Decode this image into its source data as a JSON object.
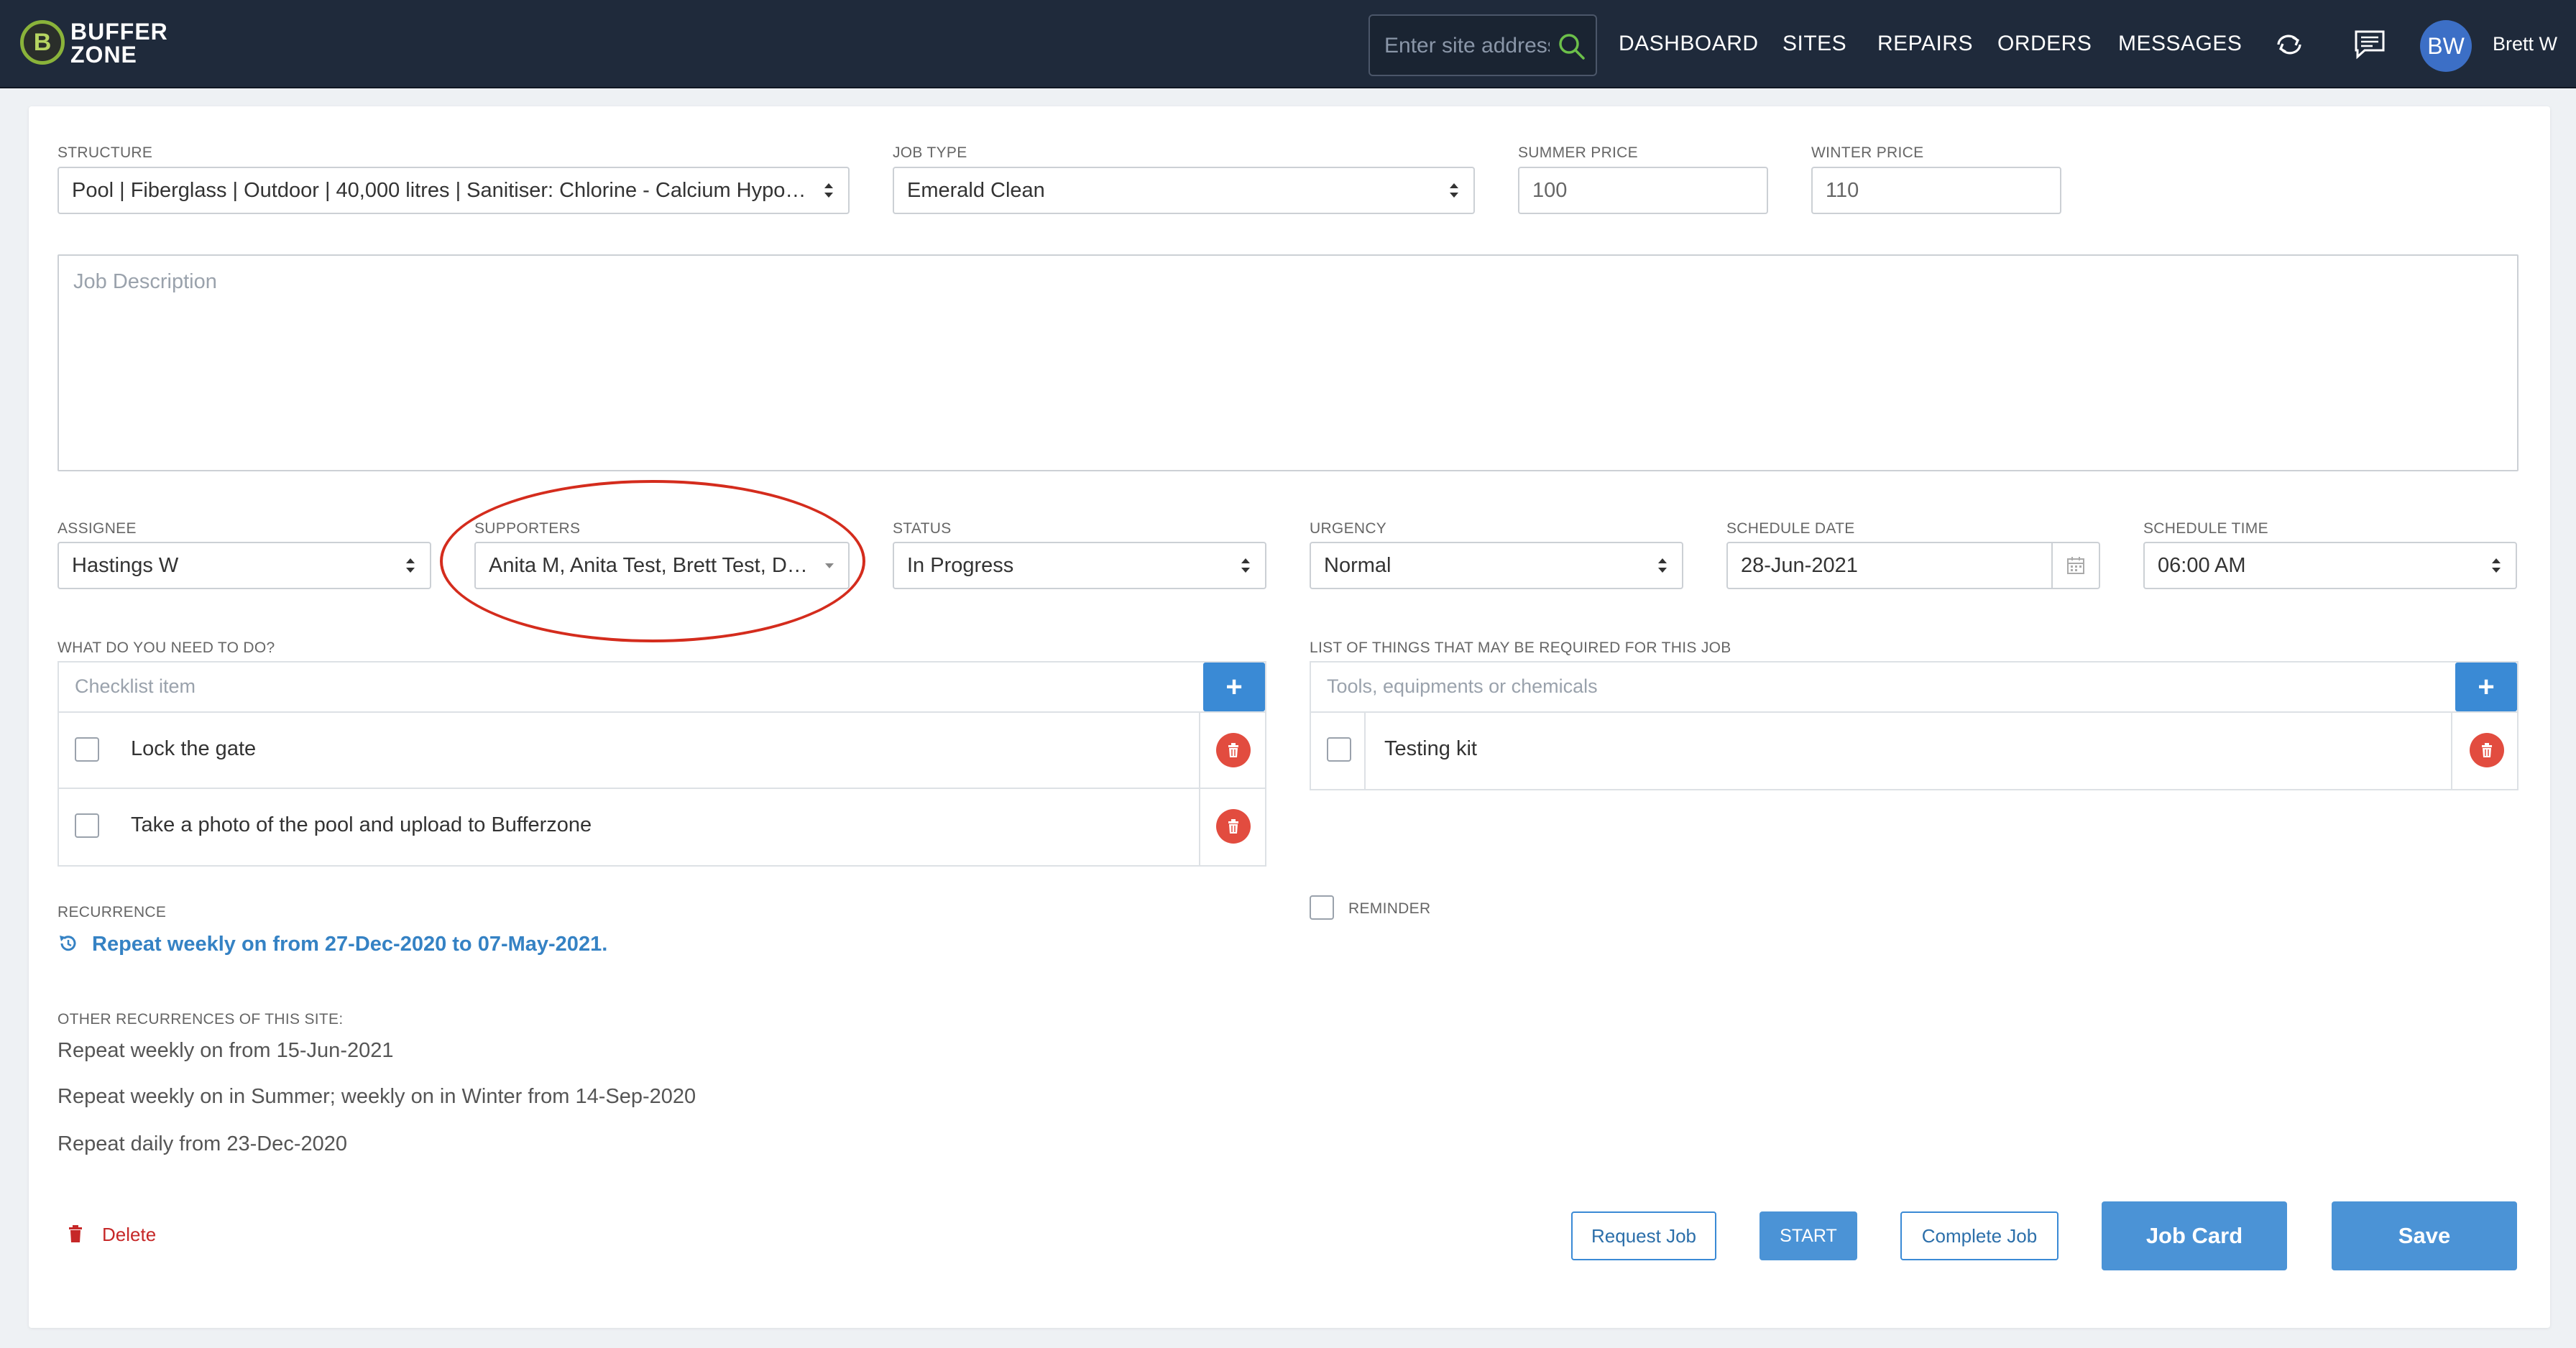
{
  "app": {
    "logo_letter": "B",
    "logo_line1": "BUFFER",
    "logo_line2": "ZONE"
  },
  "search": {
    "placeholder": "Enter site address"
  },
  "nav": [
    {
      "label": "DASHBOARD"
    },
    {
      "label": "SITES"
    },
    {
      "label": "REPAIRS"
    },
    {
      "label": "ORDERS"
    },
    {
      "label": "MESSAGES"
    }
  ],
  "user": {
    "initials": "BW",
    "name": "Brett W"
  },
  "form": {
    "structure": {
      "label": "STRUCTURE",
      "value": "Pool | Fiberglass | Outdoor | 40,000 litres | Sanitiser: Chlorine - Calcium Hypochlorite"
    },
    "job_type": {
      "label": "JOB TYPE",
      "value": "Emerald Clean"
    },
    "summer_price": {
      "label": "SUMMER PRICE",
      "value": "100"
    },
    "winter_price": {
      "label": "WINTER PRICE",
      "value": "110"
    },
    "job_description": {
      "placeholder": "Job Description"
    },
    "assignee": {
      "label": "ASSIGNEE",
      "value": "Hastings W"
    },
    "supporters": {
      "label": "SUPPORTERS",
      "value": "Anita M, Anita Test, Brett Test, David"
    },
    "status": {
      "label": "STATUS",
      "value": "In Progress"
    },
    "urgency": {
      "label": "URGENCY",
      "value": "Normal"
    },
    "schedule_date": {
      "label": "SCHEDULE DATE",
      "value": "28-Jun-2021"
    },
    "schedule_time": {
      "label": "SCHEDULE TIME",
      "value": "06:00 AM"
    }
  },
  "checklist": {
    "label": "WHAT DO YOU NEED TO DO?",
    "placeholder": "Checklist item",
    "add_label": "+",
    "items": [
      {
        "text": "Lock the gate"
      },
      {
        "text": "Take a photo of the pool and upload to Bufferzone"
      }
    ]
  },
  "requirements": {
    "label": "LIST OF THINGS THAT MAY BE REQUIRED FOR THIS JOB",
    "placeholder": "Tools, equipments or chemicals",
    "add_label": "+",
    "items": [
      {
        "text": "Testing kit"
      }
    ]
  },
  "reminder": {
    "label": "REMINDER"
  },
  "recurrence": {
    "label": "RECURRENCE",
    "value": "Repeat weekly on from 27-Dec-2020 to 07-May-2021."
  },
  "other_recurrences": {
    "label": "OTHER RECURRENCES OF THIS SITE:",
    "items": [
      "Repeat weekly on from 15-Jun-2021",
      "Repeat weekly on in Summer; weekly on in Winter from 14-Sep-2020",
      "Repeat daily from 23-Dec-2020"
    ]
  },
  "actions": {
    "delete": "Delete",
    "request_job": "Request Job",
    "start": "START",
    "complete_job": "Complete Job",
    "job_card": "Job Card",
    "save": "Save"
  },
  "colors": {
    "topbar": "#1f2a3b",
    "accent": "#3a8ad5",
    "danger": "#e24c3f",
    "highlight": "#d42c1d"
  }
}
